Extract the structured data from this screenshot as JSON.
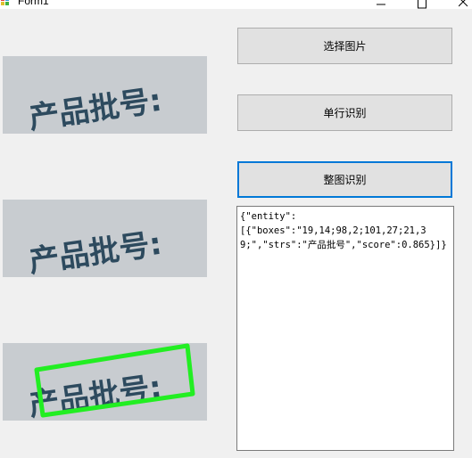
{
  "window": {
    "title": "Form1",
    "minimize_icon": "minimize-icon",
    "maximize_icon": "maximize-icon",
    "close_icon": "close-icon"
  },
  "buttons": {
    "select_image": "选择图片",
    "single_line": "单行识别",
    "whole_image": "整图识别"
  },
  "images": {
    "text": "产品批号:",
    "highlight_color": "#22ee22"
  },
  "output": {
    "text": "{\"entity\":\n[{\"boxes\":\"19,14;98,2;101,27;21,39;\",\"strs\":\"产品批号\",\"score\":0.865}]}"
  }
}
